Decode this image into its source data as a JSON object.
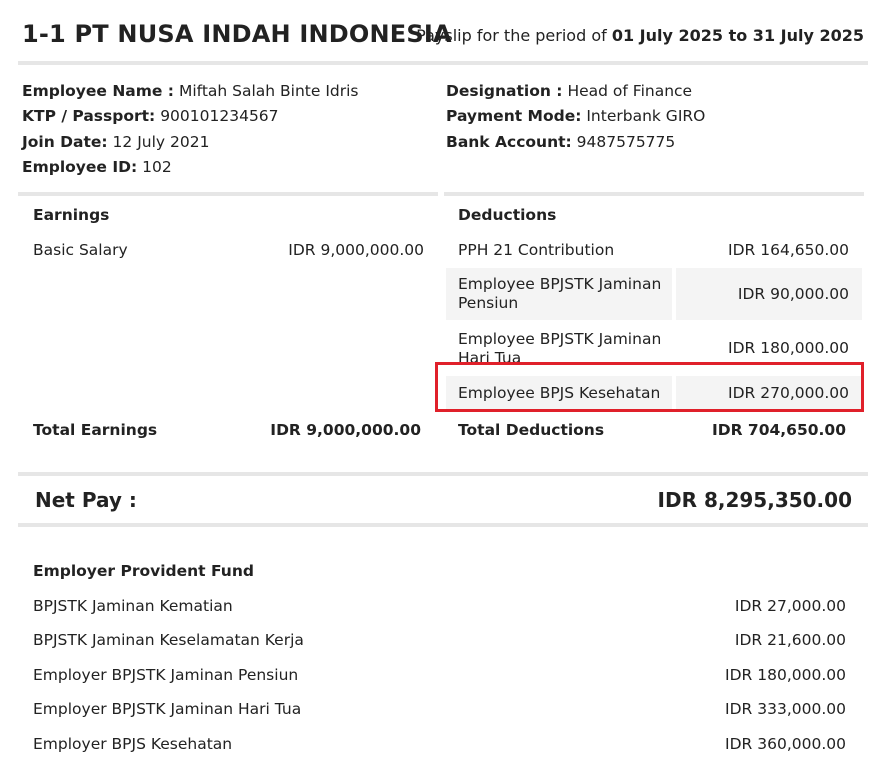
{
  "header": {
    "company": "1-1 PT NUSA INDAH INDONESIA",
    "period_prefix": "Payslip for the period of ",
    "period_range": "01 July 2025 to 31 July 2025"
  },
  "employee": {
    "name_label": "Employee Name :",
    "name_value": "Miftah Salah Binte Idris",
    "ktp_label": "KTP / Passport:",
    "ktp_value": "900101234567",
    "join_label": "Join Date:",
    "join_value": "12 July 2021",
    "id_label": "Employee ID:",
    "id_value": "102",
    "designation_label": "Designation :",
    "designation_value": "Head of Finance",
    "payment_label": "Payment Mode:",
    "payment_value": "Interbank GIRO",
    "bank_label": "Bank Account:",
    "bank_value": "9487575775"
  },
  "earnings": {
    "title": "Earnings",
    "items": [
      {
        "label": "Basic Salary",
        "value": "IDR 9,000,000.00"
      }
    ],
    "total_label": "Total Earnings",
    "total_value": "IDR 9,000,000.00"
  },
  "deductions": {
    "title": "Deductions",
    "items": [
      {
        "label": "PPH 21 Contribution",
        "value": "IDR 164,650.00"
      },
      {
        "label": "Employee BPJSTK Jaminan Pensiun",
        "value": "IDR 90,000.00"
      },
      {
        "label": "Employee BPJSTK Jaminan Hari Tua",
        "value": "IDR 180,000.00"
      },
      {
        "label": "Employee BPJS Kesehatan",
        "value": "IDR 270,000.00"
      }
    ],
    "total_label": "Total Deductions",
    "total_value": "IDR 704,650.00"
  },
  "netpay": {
    "label": "Net Pay :",
    "value": "IDR 8,295,350.00"
  },
  "provident": {
    "title": "Employer Provident Fund",
    "items": [
      {
        "label": "BPJSTK Jaminan Kematian",
        "value": "IDR 27,000.00"
      },
      {
        "label": "BPJSTK Jaminan Keselamatan Kerja",
        "value": "IDR 21,600.00"
      },
      {
        "label": "Employer BPJSTK Jaminan Pensiun",
        "value": "IDR 180,000.00"
      },
      {
        "label": "Employer BPJSTK Jaminan Hari Tua",
        "value": "IDR 333,000.00"
      },
      {
        "label": "Employer BPJS Kesehatan",
        "value": "IDR 360,000.00"
      }
    ]
  },
  "colors": {
    "highlight": "#e0202a",
    "divider": "#e6e6e6",
    "shade": "#f4f4f4"
  }
}
